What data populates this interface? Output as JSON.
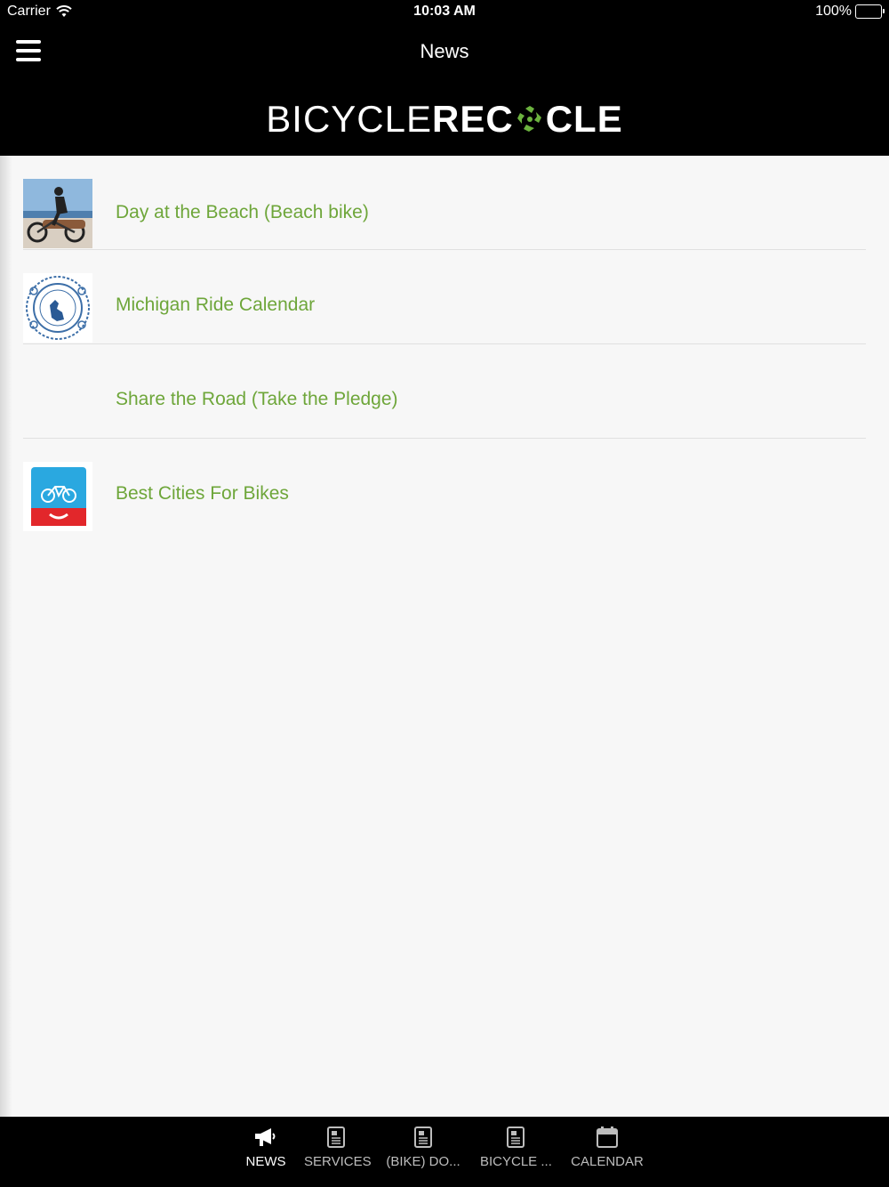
{
  "status_bar": {
    "carrier": "Carrier",
    "time": "10:03 AM",
    "battery": "100%"
  },
  "nav": {
    "title": "News"
  },
  "logo": {
    "part1": "BICYCLE",
    "part2": "REC",
    "part3": "CLE"
  },
  "news_items": [
    {
      "title": "Day at the Beach (Beach bike)",
      "thumb": "beach-bike-photo"
    },
    {
      "title": "Michigan Ride Calendar",
      "thumb": "michigan-seal"
    },
    {
      "title": "Share the Road (Take the Pledge)",
      "thumb": "none"
    },
    {
      "title": "Best Cities For Bikes",
      "thumb": "bike-app-icon"
    }
  ],
  "tabs": [
    {
      "label": "NEWS",
      "icon": "megaphone-icon",
      "active": true
    },
    {
      "label": "SERVICES",
      "icon": "document-icon"
    },
    {
      "label": "(BIKE) DO...",
      "icon": "document-icon"
    },
    {
      "label": "BICYCLE ...",
      "icon": "document-icon"
    },
    {
      "label": "CALENDAR",
      "icon": "calendar-icon"
    }
  ],
  "colors": {
    "accent_green": "#6ea63a",
    "bar_black": "#000000",
    "background": "#f7f7f7"
  }
}
